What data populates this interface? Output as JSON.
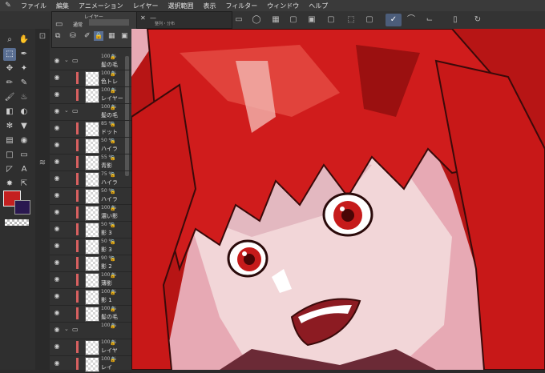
{
  "menubar": {
    "items": [
      "ファイル",
      "編集",
      "アニメーション",
      "レイヤー",
      "選択範囲",
      "表示",
      "フィルター",
      "ウィンドウ",
      "ヘルプ"
    ]
  },
  "layer_panel": {
    "popup_title": "レイヤー",
    "blend_label": "通常",
    "tab_label": "整列・分布",
    "layers": [
      {
        "pct": "100 %",
        "name": "髪の毛",
        "type": "folder"
      },
      {
        "pct": "100 %",
        "name": "色トレ",
        "type": "layer"
      },
      {
        "pct": "100 %",
        "name": "レイヤー",
        "type": "layer"
      },
      {
        "pct": "100 %",
        "name": "髪の毛",
        "type": "folder"
      },
      {
        "pct": "85 %",
        "name": "ドット",
        "type": "layer"
      },
      {
        "pct": "50 %",
        "name": "ハイラ",
        "type": "layer"
      },
      {
        "pct": "55 %",
        "name": "青影",
        "type": "layer"
      },
      {
        "pct": "75 %",
        "name": "ハイラ",
        "type": "layer"
      },
      {
        "pct": "50 %",
        "name": "ハイラ",
        "type": "layer"
      },
      {
        "pct": "100 %",
        "name": "濃い影",
        "type": "layer"
      },
      {
        "pct": "50 %",
        "name": "影 3",
        "type": "layer"
      },
      {
        "pct": "50 %",
        "name": "影 3",
        "type": "layer"
      },
      {
        "pct": "90 %",
        "name": "影 2",
        "type": "layer"
      },
      {
        "pct": "100 %",
        "name": "薄影",
        "type": "layer"
      },
      {
        "pct": "100 %",
        "name": "影 1",
        "type": "layer"
      },
      {
        "pct": "100 %",
        "name": "髪の毛",
        "type": "layer"
      },
      {
        "pct": "100 %",
        "name": "",
        "type": "folder"
      },
      {
        "pct": "100 %",
        "name": "レイヤ",
        "type": "layer"
      },
      {
        "pct": "100 %",
        "name": "レイ",
        "type": "layer"
      }
    ]
  },
  "colors": {
    "main": "#c42020",
    "sub": "#2a1850",
    "canvas_bg": "#e7a9b4"
  },
  "icons": {
    "eye": "eye-icon",
    "folder": "folder-icon",
    "lock": "lock-icon"
  }
}
